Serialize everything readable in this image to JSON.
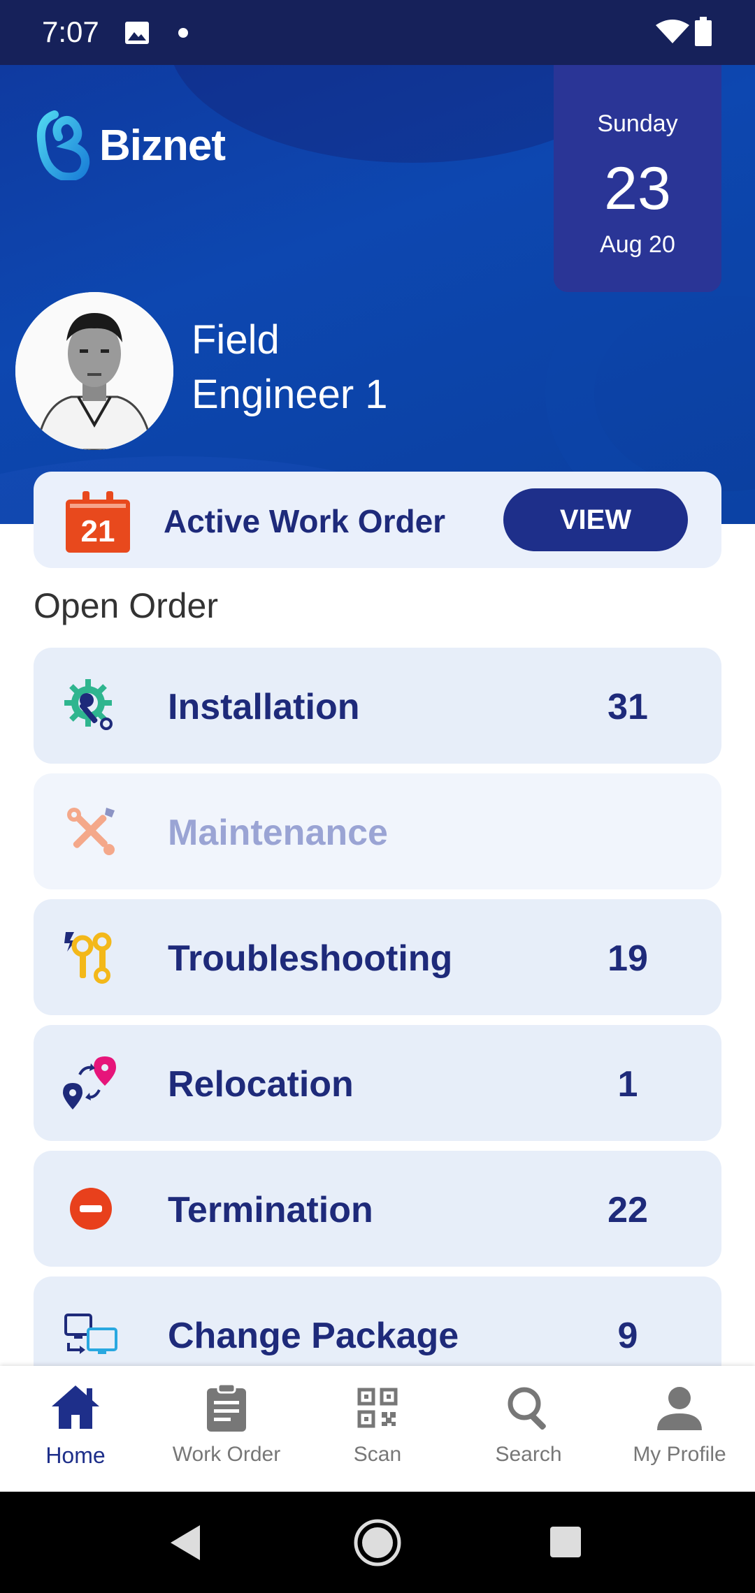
{
  "status_bar": {
    "time": "7:07"
  },
  "header": {
    "brand": "Biznet",
    "date": {
      "day_name": "Sunday",
      "day": "23",
      "month_year": "Aug 20"
    },
    "user": {
      "name_line1": "Field",
      "name_line2": "Engineer 1"
    }
  },
  "active_work_order": {
    "badge": "21",
    "label": "Active Work Order",
    "button": "VIEW"
  },
  "open_order": {
    "title": "Open Order",
    "items": [
      {
        "label": "Installation",
        "count": "31",
        "icon": "installation-gear-wrench-icon",
        "enabled": true
      },
      {
        "label": "Maintenance",
        "count": "",
        "icon": "maintenance-tools-icon",
        "enabled": false
      },
      {
        "label": "Troubleshooting",
        "count": "19",
        "icon": "troubleshooting-wrench-bolt-icon",
        "enabled": true
      },
      {
        "label": "Relocation",
        "count": "1",
        "icon": "relocation-pins-icon",
        "enabled": true
      },
      {
        "label": "Termination",
        "count": "22",
        "icon": "termination-minus-icon",
        "enabled": true
      },
      {
        "label": "Change Package",
        "count": "9",
        "icon": "change-package-monitors-icon",
        "enabled": true
      }
    ]
  },
  "bottom_nav": {
    "items": [
      {
        "label": "Home",
        "icon": "home-icon",
        "active": true
      },
      {
        "label": "Work Order",
        "icon": "clipboard-icon",
        "active": false
      },
      {
        "label": "Scan",
        "icon": "qr-code-icon",
        "active": false
      },
      {
        "label": "Search",
        "icon": "search-icon",
        "active": false
      },
      {
        "label": "My Profile",
        "icon": "person-icon",
        "active": false
      }
    ]
  },
  "colors": {
    "primary": "#1e2f8a",
    "header": "#0d47b0",
    "card": "#e7eef9",
    "badge": "#e8491d"
  }
}
